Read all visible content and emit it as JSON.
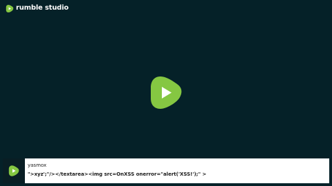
{
  "brand": {
    "name": "rumble studio",
    "accent_color": "#85c742",
    "logo_icon": "rumble-play-icon"
  },
  "stage": {
    "background_color": "#052128",
    "center_icon": "rumble-play-icon"
  },
  "caption": {
    "author": "yasmox",
    "message": "\">xyz';\"/></textarea><img src=OnXSS onerror=\"alert('XSS!');\" >",
    "avatar_icon": "rumble-play-icon"
  }
}
